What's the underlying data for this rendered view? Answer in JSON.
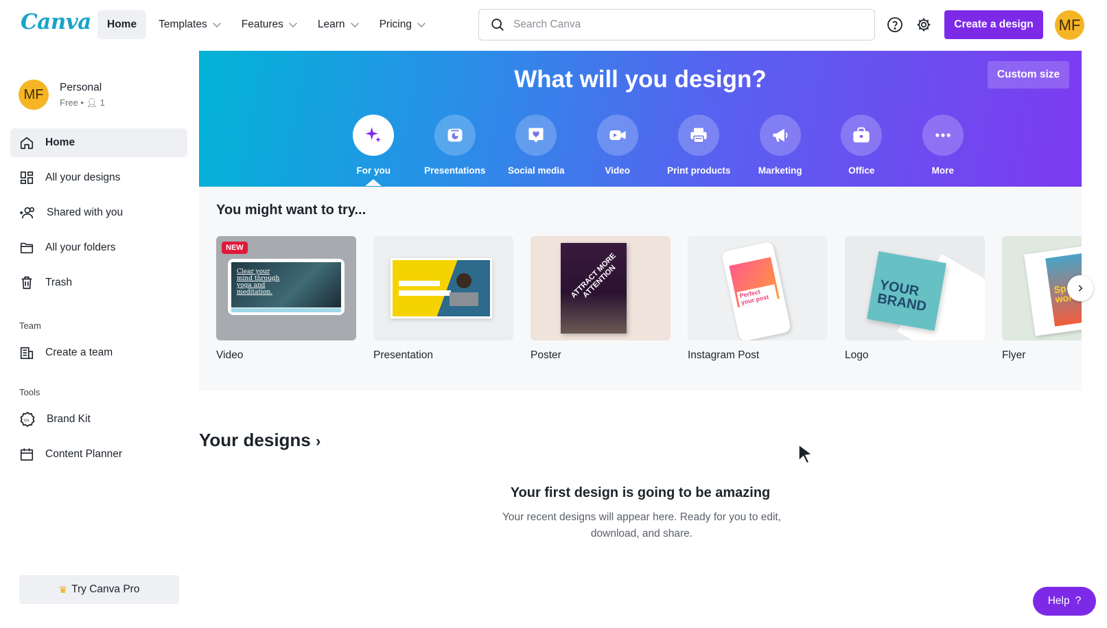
{
  "brand": {
    "logo_text": "Canva",
    "accent": "#7d2ae8"
  },
  "nav": {
    "items": [
      {
        "label": "Home",
        "active": true,
        "dropdown": false
      },
      {
        "label": "Templates",
        "active": false,
        "dropdown": true
      },
      {
        "label": "Features",
        "active": false,
        "dropdown": true
      },
      {
        "label": "Learn",
        "active": false,
        "dropdown": true
      },
      {
        "label": "Pricing",
        "active": false,
        "dropdown": true
      }
    ]
  },
  "search": {
    "placeholder": "Search Canva",
    "value": ""
  },
  "header": {
    "create_label": "Create a design",
    "avatar_initials": "MF"
  },
  "account": {
    "name": "Personal",
    "plan": "Free • ",
    "members": "1",
    "avatar_initials": "MF"
  },
  "sidebar": {
    "items": [
      {
        "label": "Home",
        "icon": "home-icon",
        "active": true
      },
      {
        "label": "All your designs",
        "icon": "grid-icon",
        "active": false
      },
      {
        "label": "Shared with you",
        "icon": "shared-users-icon",
        "active": false
      },
      {
        "label": "All your folders",
        "icon": "folder-icon",
        "active": false
      },
      {
        "label": "Trash",
        "icon": "trash-icon",
        "active": false
      }
    ],
    "team_heading": "Team",
    "team_items": [
      {
        "label": "Create a team",
        "icon": "team-icon"
      }
    ],
    "tools_heading": "Tools",
    "tool_items": [
      {
        "label": "Brand Kit",
        "icon": "brand-kit-icon"
      },
      {
        "label": "Content Planner",
        "icon": "calendar-icon"
      }
    ],
    "try_pro_label": "Try Canva Pro"
  },
  "hero": {
    "title": "What will you design?",
    "custom_size_label": "Custom size",
    "categories": [
      {
        "label": "For you",
        "icon": "sparkle-icon",
        "active": true
      },
      {
        "label": "Presentations",
        "icon": "presentation-icon",
        "active": false
      },
      {
        "label": "Social media",
        "icon": "heart-icon",
        "active": false
      },
      {
        "label": "Video",
        "icon": "video-icon",
        "active": false
      },
      {
        "label": "Print products",
        "icon": "printer-icon",
        "active": false
      },
      {
        "label": "Marketing",
        "icon": "megaphone-icon",
        "active": false
      },
      {
        "label": "Office",
        "icon": "briefcase-icon",
        "active": false
      },
      {
        "label": "More",
        "icon": "more-dots-icon",
        "active": false
      }
    ]
  },
  "suggestions": {
    "title": "You might want to try...",
    "new_badge": "NEW",
    "video_thumb_text": "Clear your mind through yoga and meditation.",
    "poster_thumb_text": "ATTRACT MORE ATTENTION",
    "instagram_thumb_text": "Perfect your post",
    "logo_thumb_text": "YOUR BRAND",
    "flyer_thumb_text": "Sp the word",
    "cards": [
      {
        "label": "Video"
      },
      {
        "label": "Presentation"
      },
      {
        "label": "Poster"
      },
      {
        "label": "Instagram Post"
      },
      {
        "label": "Logo"
      },
      {
        "label": "Flyer"
      }
    ]
  },
  "designs": {
    "title": "Your designs",
    "empty_title": "Your first design is going to be amazing",
    "empty_line1": "Your recent designs will appear here. Ready for you to edit,",
    "empty_line2": "download, and share."
  },
  "help": {
    "label": "Help",
    "symbol": "?"
  }
}
